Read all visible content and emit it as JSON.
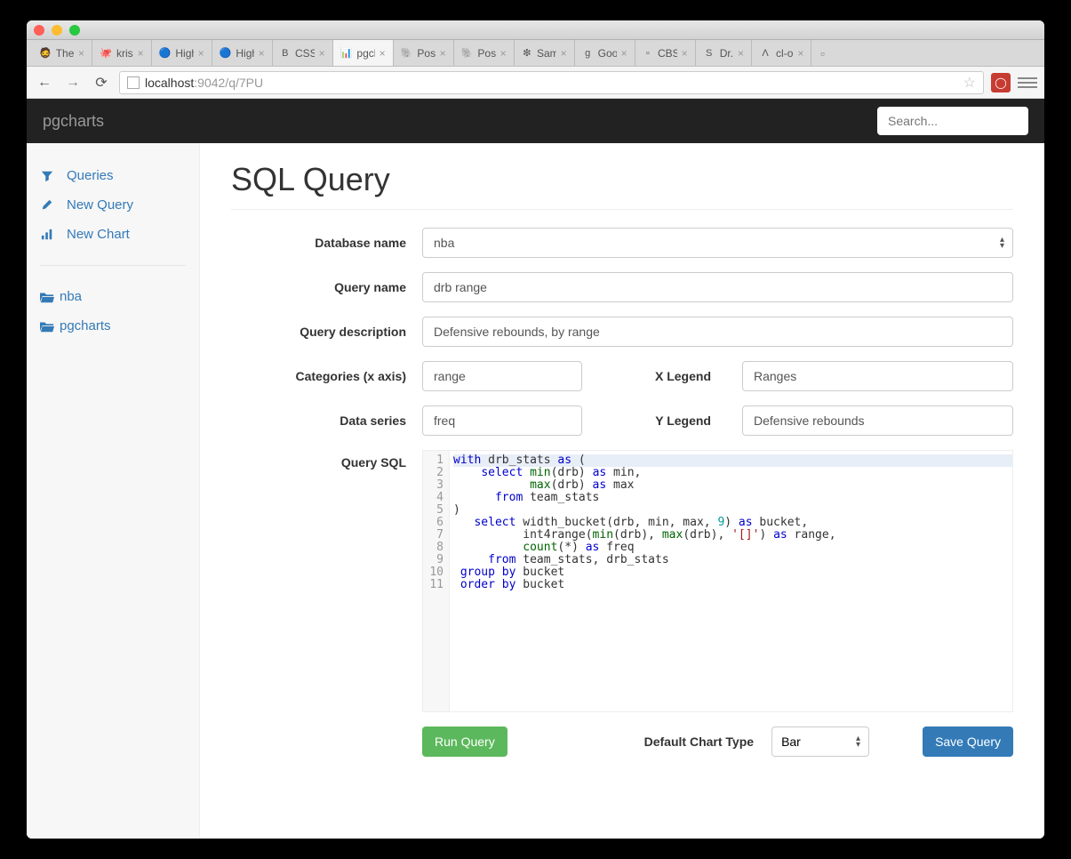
{
  "browser": {
    "tabs": [
      {
        "label": "The",
        "favicon": "🧔"
      },
      {
        "label": "kris",
        "favicon": "🐙"
      },
      {
        "label": "High",
        "favicon": "🔵"
      },
      {
        "label": "High",
        "favicon": "🔵"
      },
      {
        "label": "CSS",
        "favicon": "B"
      },
      {
        "label": "pgch",
        "favicon": "📊",
        "active": true
      },
      {
        "label": "Post",
        "favicon": "🐘"
      },
      {
        "label": "Post",
        "favicon": "🐘"
      },
      {
        "label": "Sam",
        "favicon": "❇"
      },
      {
        "label": "Goo",
        "favicon": "g"
      },
      {
        "label": "CBS",
        "favicon": "▫"
      },
      {
        "label": "Dr.",
        "favicon": "S"
      },
      {
        "label": "cl-o",
        "favicon": "Λ"
      }
    ],
    "url_host": "localhost",
    "url_path": ":9042/q/7PU"
  },
  "navbar": {
    "brand": "pgcharts",
    "search_placeholder": "Search..."
  },
  "sidebar": {
    "queries": "Queries",
    "new_query": "New   Query",
    "new_chart": "New   Chart",
    "folders": [
      "nba",
      "pgcharts"
    ]
  },
  "page": {
    "title": "SQL Query",
    "labels": {
      "database_name": "Database name",
      "query_name": "Query name",
      "query_description": "Query description",
      "categories": "Categories (x axis)",
      "data_series": "Data series",
      "x_legend": "X Legend",
      "y_legend": "Y Legend",
      "query_sql": "Query SQL",
      "default_chart_type": "Default Chart Type"
    },
    "fields": {
      "database_name": "nba",
      "query_name": "drb range",
      "query_description": "Defensive rebounds, by range",
      "categories": "range",
      "data_series": "freq",
      "x_legend": "Ranges",
      "y_legend": "Defensive rebounds",
      "default_chart_type": "Bar"
    },
    "buttons": {
      "run": "Run Query",
      "save": "Save Query"
    },
    "sql_lines": 11
  }
}
